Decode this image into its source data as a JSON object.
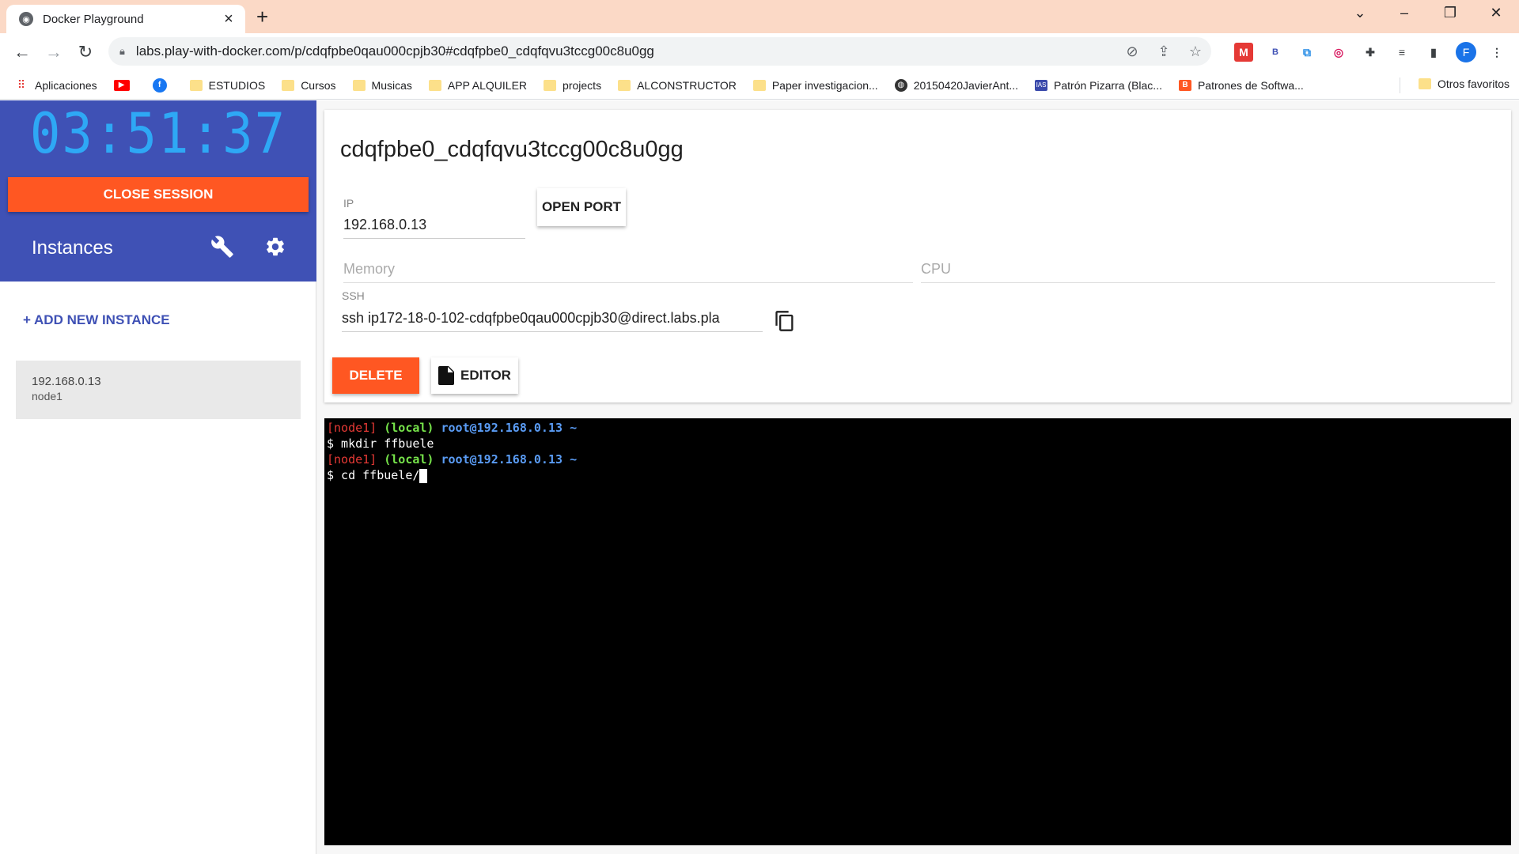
{
  "browser": {
    "tab_title": "Docker Playground",
    "url": "labs.play-with-docker.com/p/cdqfpbe0qau000cpjb30#cdqfpbe0_cdqfqvu3tccg00c8u0gg",
    "avatar_letter": "F",
    "bookmarks": [
      {
        "label": "Aplicaciones",
        "icon": "apps-icon"
      },
      {
        "label": "",
        "icon": "youtube-icon"
      },
      {
        "label": "",
        "icon": "facebook-icon"
      },
      {
        "label": "ESTUDIOS",
        "icon": "folder-icon"
      },
      {
        "label": "Cursos",
        "icon": "folder-icon"
      },
      {
        "label": "Musicas",
        "icon": "folder-icon"
      },
      {
        "label": "APP ALQUILER",
        "icon": "folder-icon"
      },
      {
        "label": "projects",
        "icon": "folder-icon"
      },
      {
        "label": "ALCONSTRUCTOR",
        "icon": "folder-icon"
      },
      {
        "label": "Paper investigacion...",
        "icon": "folder-icon"
      },
      {
        "label": "20150420JavierAnt...",
        "icon": "globe-icon"
      },
      {
        "label": "Patrón Pizarra (Blac...",
        "icon": "ias-icon"
      },
      {
        "label": "Patrones de Softwa...",
        "icon": "blogger-icon"
      }
    ],
    "other_bookmarks": "Otros favoritos"
  },
  "sidebar": {
    "timer": "03:51:37",
    "close_session": "CLOSE SESSION",
    "instances_title": "Instances",
    "add_instance": "+ ADD NEW INSTANCE",
    "instances": [
      {
        "ip": "192.168.0.13",
        "name": "node1"
      }
    ]
  },
  "instance": {
    "title": "cdqfpbe0_cdqfqvu3tccg00c8u0gg",
    "ip_label": "IP",
    "ip_value": "192.168.0.13",
    "open_port": "OPEN PORT",
    "memory_placeholder": "Memory",
    "cpu_placeholder": "CPU",
    "ssh_label": "SSH",
    "ssh_value": "ssh ip172-18-0-102-cdqfpbe0qau000cpjb30@direct.labs.pla",
    "delete_label": "DELETE",
    "editor_label": "EDITOR"
  },
  "terminal": {
    "node": "[node1]",
    "local": "(local)",
    "user_host": "root@192.168.0.13",
    "tilde": "~",
    "cmd1": "$ mkdir ffbuele",
    "cmd2": "$ cd ffbuele/"
  },
  "colors": {
    "accent": "#3f51b5",
    "danger": "#ff5722",
    "timer": "#2ea8f5"
  }
}
